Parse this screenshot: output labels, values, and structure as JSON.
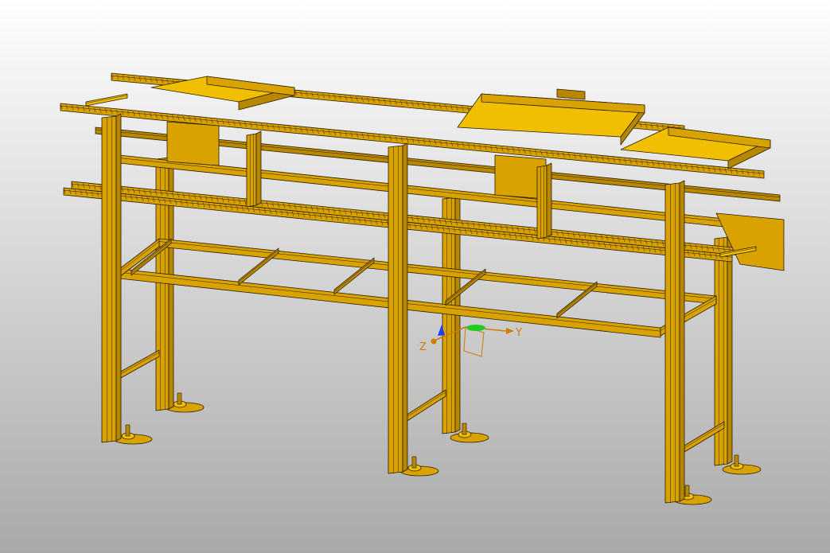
{
  "viewport": {
    "background_top": "#ffffff",
    "background_bottom": "#a9a9a9"
  },
  "model": {
    "body_color": "#d8a200",
    "shade_color": "#b88700",
    "highlight_color": "#f0c000",
    "edge_color": "#2a1c00"
  },
  "triad": {
    "y_label": "Y",
    "z_label": "Z",
    "y_color": "#d07a00",
    "z_color": "#d07a00",
    "x_color": "#1c3cff",
    "handle_color": "#22cc22"
  }
}
